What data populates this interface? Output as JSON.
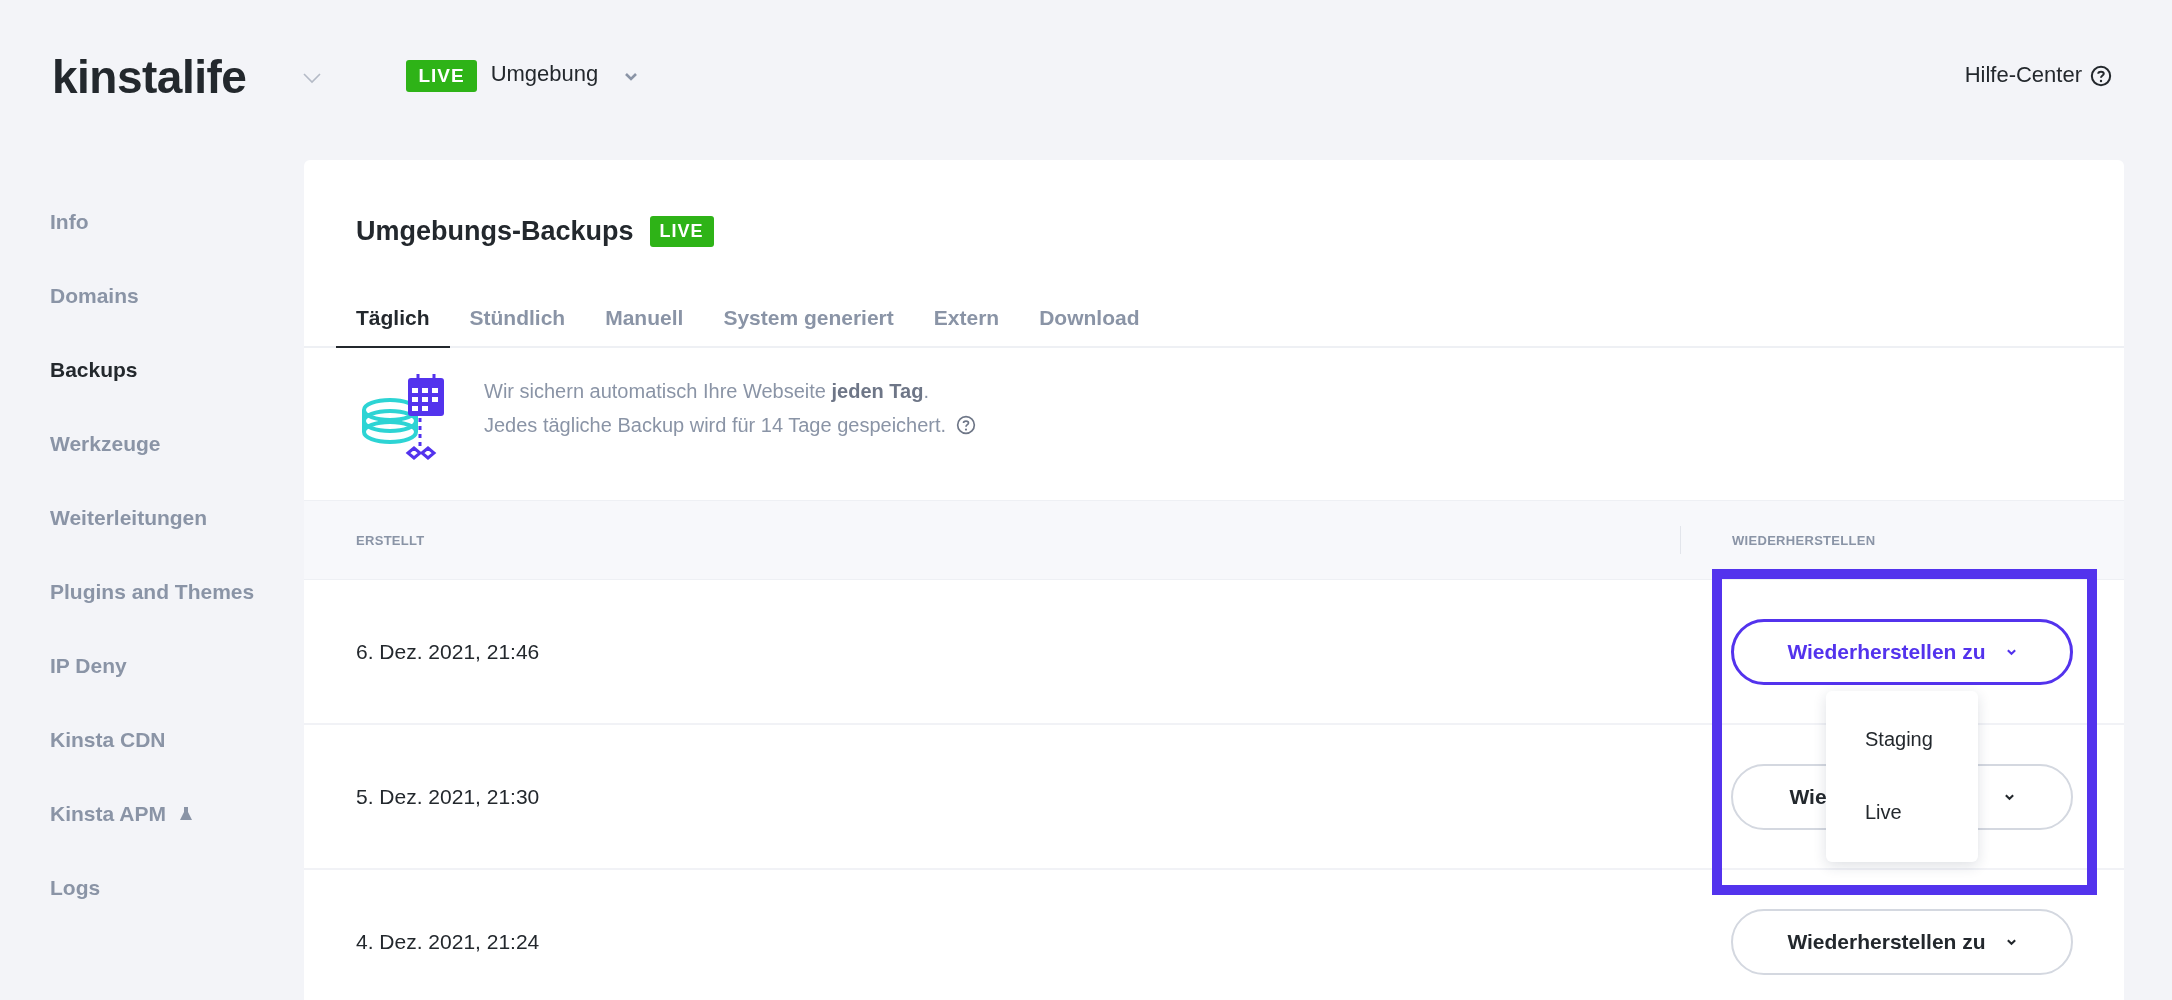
{
  "header": {
    "logo": "kinstalife",
    "environment_badge": "LIVE",
    "environment": "Umgebung",
    "help_link": "Hilfe-Center"
  },
  "sidebar": {
    "items": [
      {
        "label": "Info",
        "selected": false,
        "beta": false
      },
      {
        "label": "Domains",
        "selected": false,
        "beta": false
      },
      {
        "label": "Backups",
        "selected": true,
        "beta": false
      },
      {
        "label": "Werkzeuge",
        "selected": false,
        "beta": false
      },
      {
        "label": "Weiterleitungen",
        "selected": false,
        "beta": false
      },
      {
        "label": "Plugins and Themes",
        "selected": false,
        "beta": false
      },
      {
        "label": "IP Deny",
        "selected": false,
        "beta": false
      },
      {
        "label": "Kinsta CDN",
        "selected": false,
        "beta": false
      },
      {
        "label": "Kinsta APM",
        "selected": false,
        "beta": true
      },
      {
        "label": "Logs",
        "selected": false,
        "beta": false
      }
    ]
  },
  "card": {
    "title": "Umgebungs-Backups",
    "badge": "LIVE",
    "tabs": [
      {
        "label": "Täglich",
        "selected": true
      },
      {
        "label": "Stündlich",
        "selected": false
      },
      {
        "label": "Manuell",
        "selected": false
      },
      {
        "label": "System generiert",
        "selected": false
      },
      {
        "label": "Extern",
        "selected": false
      },
      {
        "label": "Download",
        "selected": false
      }
    ],
    "info": {
      "lines": [
        "Wir sichern automatisch Ihre Webseite **jeden Tag**.",
        "Jedes tägliche Backup wird für 14 Tage gespeichert."
      ]
    },
    "table": {
      "columns": [
        "ERSTELLT",
        "WIEDERHERSTELLEN"
      ],
      "rows": [
        {
          "created": "6. Dez. 2021, 21:46",
          "button": {
            "label": "Wiederherstellen zu",
            "expanded": true
          }
        },
        {
          "created": "5. Dez. 2021, 21:30",
          "button": {
            "visible_label": "Wie",
            "expanded": false
          }
        },
        {
          "created": "4. Dez. 2021, 21:24",
          "button": {
            "label": "Wiederherstellen zu",
            "expanded": false
          }
        }
      ]
    },
    "dropdown": {
      "items": [
        "Staging",
        "Live"
      ]
    }
  }
}
